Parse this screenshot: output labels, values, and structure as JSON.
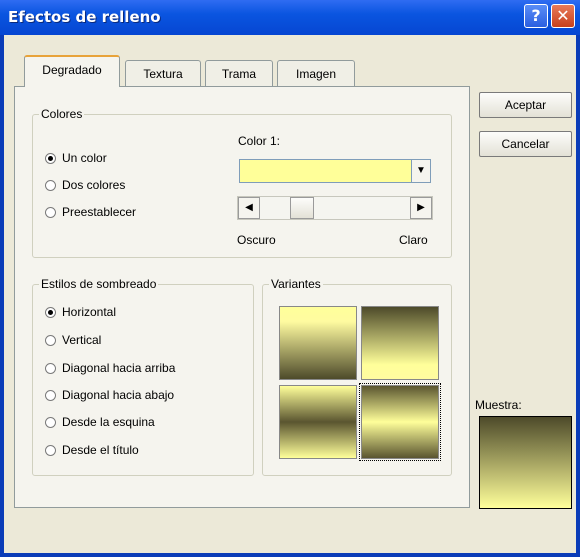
{
  "window": {
    "title": "Efectos de relleno",
    "help_glyph": "?",
    "close_glyph": "✕"
  },
  "tabs": [
    "Degradado",
    "Textura",
    "Trama",
    "Imagen"
  ],
  "colores": {
    "legend": "Colores",
    "color1_label": "Color 1:",
    "color1_value": "#ffff99",
    "options": [
      "Un color",
      "Dos colores",
      "Preestablecer"
    ],
    "selected": "Un color",
    "slider_left": "Oscuro",
    "slider_right": "Claro"
  },
  "sombreado": {
    "legend": "Estilos de sombreado",
    "options": [
      "Horizontal",
      "Vertical",
      "Diagonal hacia arriba",
      "Diagonal hacia abajo",
      "Desde la esquina",
      "Desde el título"
    ],
    "selected": "Horizontal"
  },
  "variantes": {
    "legend": "Variantes"
  },
  "buttons": {
    "ok": "Aceptar",
    "cancel": "Cancelar"
  },
  "muestra_label": "Muestra:",
  "icons": {
    "dropdown": "▼",
    "scroll_left": "◀",
    "scroll_right": "▶"
  }
}
